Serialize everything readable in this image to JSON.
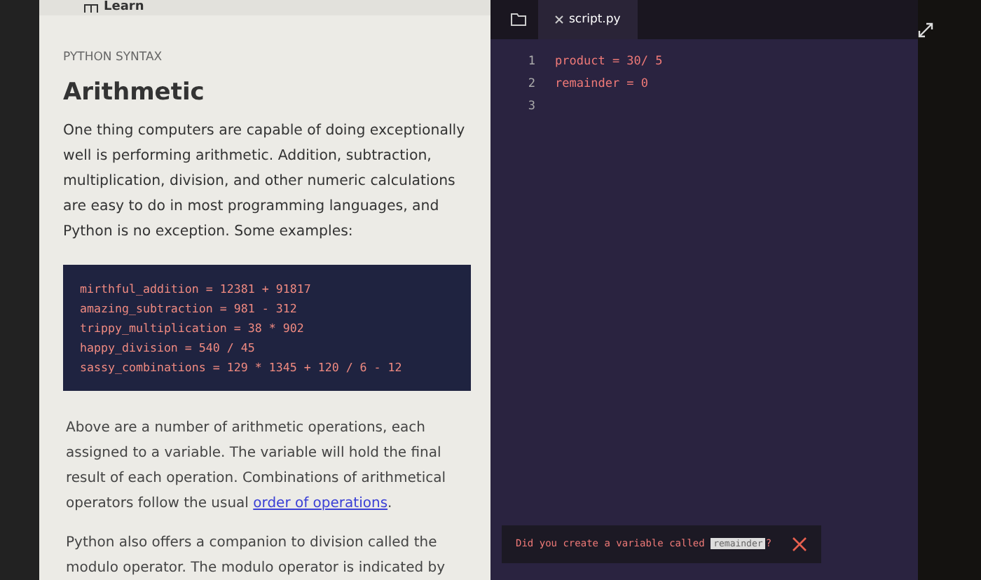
{
  "header": {
    "title": "Learn"
  },
  "lesson": {
    "category": "PYTHON SYNTAX",
    "title": "Arithmetic",
    "intro": "One thing computers are capable of doing exceptionally well is performing arithmetic. Addition, subtraction, multiplication, division, and other numeric calculations are easy to do in most programming languages, and Python is no exception. Some examples:",
    "code_lines": [
      "mirthful_addition = 12381 + 91817",
      "amazing_subtraction = 981 - 312",
      "trippy_multiplication = 38 * 902",
      "happy_division = 540 / 45",
      "sassy_combinations = 129 * 1345 + 120 / 6 - 12"
    ],
    "paragraph_text": "Above are a number of arithmetic operations, each assigned to a variable. The variable will hold the final result of each operation. Combinations of arithmetical operators follow the usual ",
    "paragraph_link": "order of operations",
    "paragraph_end": ".",
    "last_paragraph": "Python also offers a companion to division called the modulo operator. The modulo operator is indicated by"
  },
  "editor": {
    "tabs": [
      {
        "label": "script.py",
        "selected": true
      }
    ],
    "lines": [
      {
        "number": "1",
        "code": "product = 30/ 5"
      },
      {
        "number": "2",
        "code": "remainder = 0"
      },
      {
        "number": "3"
      }
    ],
    "error": {
      "before": "Did you create a variable called",
      "code": "remainder",
      "after": "?"
    }
  }
}
